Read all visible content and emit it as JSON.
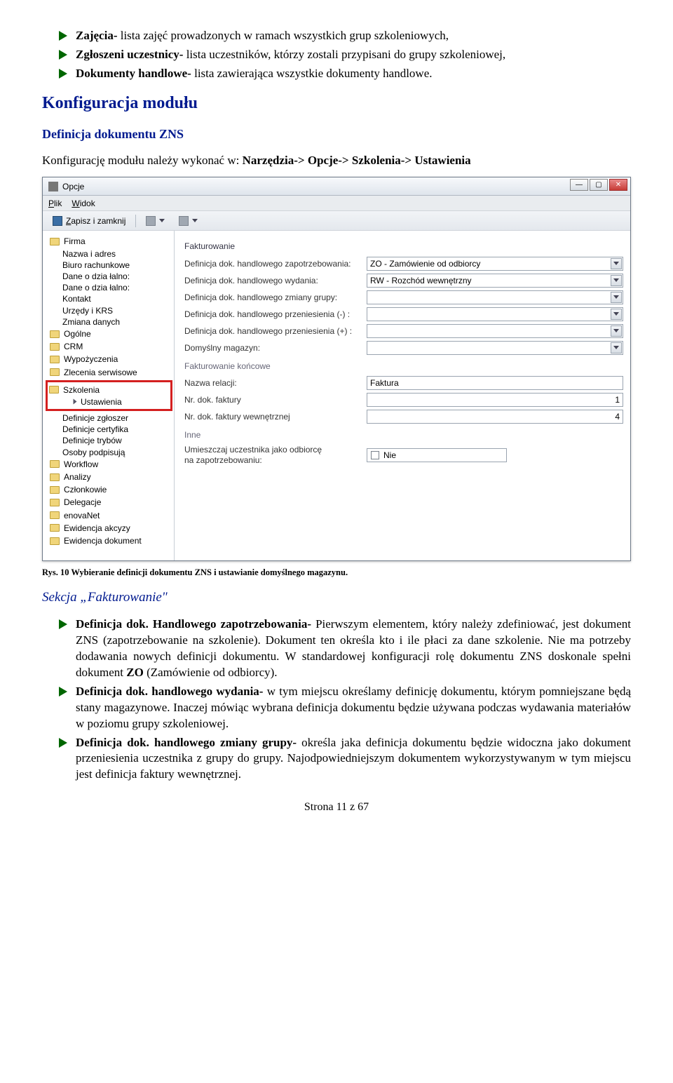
{
  "bullets_top": [
    {
      "b": "Zajęcia-",
      "t": " lista zajęć prowadzonych w ramach wszystkich grup szkoleniowych,"
    },
    {
      "b": "Zgłoszeni uczestnicy-",
      "t": " lista uczestników, którzy zostali przypisani do grupy szkoleniowej,"
    },
    {
      "b": "Dokumenty handlowe-",
      "t": " lista zawierająca wszystkie dokumenty handlowe."
    }
  ],
  "h2": "Konfiguracja modułu",
  "h3a": "Definicja dokumentu ZNS",
  "para": "Konfigurację modułu należy wykonać w: ",
  "para_bold": "Narzędzia-> Opcje-> Szkolenia-> Ustawienia",
  "figcap": "Rys. 10 Wybieranie definicji dokumentu ZNS i ustawianie domyślnego magazynu.",
  "h3b": "Sekcja „Fakturowanie\"",
  "bullets_bottom": [
    {
      "b": "Definicja dok. Handlowego zapotrzebowania-",
      "t": " Pierwszym elementem, który należy zdefiniować, jest dokument ZNS (zapotrzebowanie na szkolenie). Dokument ten określa kto i ile płaci za dane szkolenie. Nie ma potrzeby dodawania nowych definicji dokumentu. W standardowej konfiguracji rolę dokumentu ZNS doskonale spełni dokument ",
      "b2": "ZO",
      "t2": " (Zamówienie od odbiorcy)."
    },
    {
      "b": "Definicja dok. handlowego wydania-",
      "t": " w tym miejscu określamy definicję dokumentu, którym pomniejszane będą stany magazynowe. Inaczej mówiąc wybrana definicja dokumentu będzie używana podczas wydawania materiałów w poziomu grupy szkoleniowej."
    },
    {
      "b": "Definicja dok. handlowego zmiany grupy-",
      "t": " określa jaka definicja dokumentu będzie widoczna jako dokument przeniesienia uczestnika z grupy do grupy. Najodpowiedniejszym dokumentem wykorzystywanym w tym miejscu jest definicja faktury wewnętrznej."
    }
  ],
  "page": "Strona 11 z 67",
  "win": {
    "title": "Opcje",
    "menu": {
      "plik": "Plik",
      "widok": "Widok"
    },
    "toolbar": {
      "save": "Zapisz i zamknij"
    },
    "tree": {
      "firma": "Firma",
      "firma_leaves": [
        "Nazwa i adres",
        "Biuro rachunkowe",
        "Dane o dzia łalno:",
        "Dane o dzia łalno:",
        "Kontakt",
        "Urzędy i KRS",
        "Zmiana danych"
      ],
      "ogolne": "Ogólne",
      "crm": "CRM",
      "wypo": "Wypożyczenia",
      "zlecserw": "Zlecenia serwisowe",
      "szkolenia": "Szkolenia",
      "ustawienia": "Ustawienia",
      "szk_leaves": [
        "Definicje zgłoszer",
        "Definicje certyfika",
        "Definicje trybów",
        "Osoby podpisują"
      ],
      "rest": [
        "Workflow",
        "Analizy",
        "Członkowie",
        "Delegacje",
        "enovaNet",
        "Ewidencja akcyzy",
        "Ewidencja dokument"
      ]
    },
    "form": {
      "g1": "Fakturowanie",
      "r1": {
        "lbl": "Definicja dok. handlowego zapotrzebowania:",
        "val": "ZO - Zamówienie od odbiorcy"
      },
      "r2": {
        "lbl": "Definicja dok. handlowego wydania:",
        "val": "RW - Rozchód wewnętrzny"
      },
      "r3": {
        "lbl": "Definicja dok. handlowego zmiany grupy:",
        "val": ""
      },
      "r4": {
        "lbl": "Definicja dok. handlowego przeniesienia (-) :",
        "val": ""
      },
      "r5": {
        "lbl": "Definicja dok. handlowego przeniesienia (+) :",
        "val": ""
      },
      "r6": {
        "lbl": "Domyślny magazyn:",
        "val": ""
      },
      "g2": "Fakturowanie końcowe",
      "r7": {
        "lbl": "Nazwa relacji:",
        "val": "Faktura"
      },
      "r8": {
        "lbl": "Nr. dok. faktury",
        "val": "1"
      },
      "r9": {
        "lbl": "Nr. dok. faktury wewnętrznej",
        "val": "4"
      },
      "g3": "Inne",
      "r10": {
        "lbl1": "Umieszczaj uczestnika jako odbiorcę",
        "lbl2": "na zapotrzebowaniu:",
        "val": "Nie"
      }
    }
  }
}
